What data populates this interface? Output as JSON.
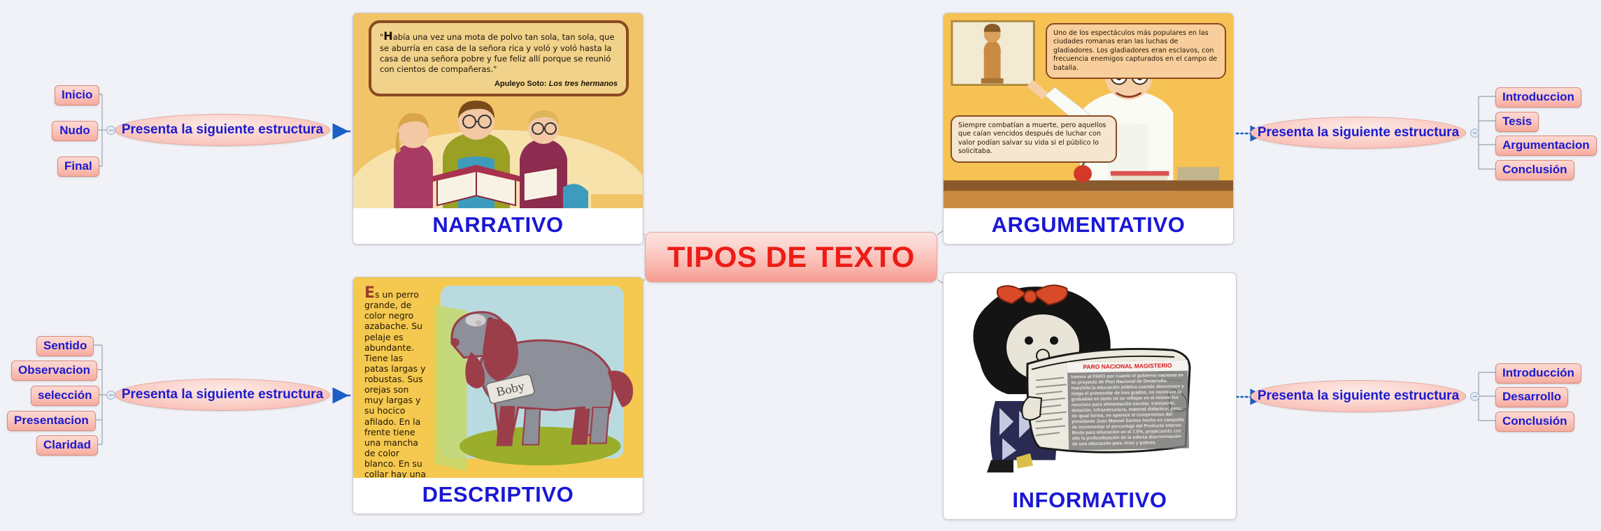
{
  "page": {
    "title": "TIPOS DE TEXTO",
    "background_color": "#f0f2f7",
    "accent_red": "#ed1c16",
    "accent_blue": "#1c1ad2",
    "node_fill": "#fac8bf"
  },
  "root": {
    "label": "TIPOS DE TEXTO"
  },
  "branch_label": "Presenta la siguiente estructura",
  "cards": {
    "narrativo": {
      "title": "NARRATIVO",
      "quote_dropcap": "H",
      "quote": "abía una vez una mota de polvo tan sola, tan sola, que se aburría en casa de la señora rica y voló y  voló hasta la casa de una señora pobre y fue feliz allí porque se reunió con cientos de compañeras.\"",
      "quote_open": "\"",
      "attrib_author": "Apuleyo Soto:",
      "attrib_work": "Los tres hermanos",
      "art_description": "children-reading-book-illustration"
    },
    "argumentativo": {
      "title": "ARGUMENTATIVO",
      "bubble_1": "Uno de los espectáculos más populares en las ciudades romanas eran las luchas de gladiadores. Los gladiadores eran esclavos, con frecuencia enemigos capturados en el campo de batalla.",
      "bubble_2": "Siempre combatían a muerte, pero aquellos que caían vencidos después de luchar con valor podían salvar su vida si el público lo solicitaba.",
      "art_description": "teacher-pointing-gladiator-statue-illustration"
    },
    "descriptivo": {
      "title": "DESCRIPTIVO",
      "dropcap": "E",
      "text": "s un perro grande, de color negro azabache. Su pelaje es abundante. Tiene las patas largas y robustas. Sus orejas son muy largas y su hocico afilado. En la frente tiene una mancha de color blanco. En su collar hay una placa en la que podrás leer su nombre: Boby.",
      "dog_tag": "Boby",
      "art_description": "spaniel-dog-illustration"
    },
    "informativo": {
      "title": "INFORMATIVO",
      "news_headline": "PARO NACIONAL MAGISTERIO",
      "news_body": "Iremos al PARO por cuanto el gobierno nacional en su proyecto de Plan Nacional de Desarrollo, marchita la educación pública cuando desconoce y niega el preescolar de tres grados, no reconoce la gratuidad en tanto no se reflejan en el mismo los recursos para alimentación escolar, transporte, dotación, infraestructura, material didáctico; pero, de igual forma, no aparece el compromiso del presidente Juan Manuel Santos hecho en campaña de incrementar el porcentaje del Producto Interno Bruto para educación en el 7.5%, propiciando con ello la profundización de la odiosa discriminación de una educación para ricos y pobres.",
      "art_description": "mafalda-reading-newspaper-illustration"
    }
  },
  "structures": {
    "narrativo": [
      "Inicio",
      "Nudo",
      "Final"
    ],
    "descriptivo": [
      "Sentido",
      "Observacion",
      "selección",
      "Presentacion",
      "Claridad"
    ],
    "argumentativo": [
      "Introduccion",
      "Tesis",
      "Argumentacion",
      "Conclusión"
    ],
    "informativo": [
      "Introducción",
      "Desarrollo",
      "Conclusión"
    ]
  }
}
